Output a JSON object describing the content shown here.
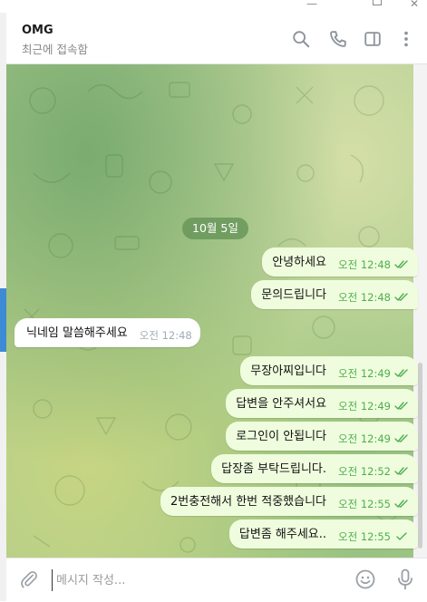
{
  "chat": {
    "name": "OMG",
    "status": "최근에 접속함"
  },
  "date_separator": "10월 5일",
  "messages": [
    {
      "text": "안녕하세요",
      "time": "오전 12:48",
      "direction": "out",
      "read": true
    },
    {
      "text": "문의드립니다",
      "time": "오전 12:48",
      "direction": "out",
      "read": true
    },
    {
      "text": "닉네임 말씀해주세요",
      "time": "오전 12:48",
      "direction": "in"
    },
    {
      "text": "무장아찌입니다",
      "time": "오전 12:49",
      "direction": "out",
      "read": true
    },
    {
      "text": "답변을 안주셔서요",
      "time": "오전 12:49",
      "direction": "out",
      "read": true
    },
    {
      "text": "로그인이 안됩니다",
      "time": "오전 12:49",
      "direction": "out",
      "read": true
    },
    {
      "text": "답장좀 부탁드립니다.",
      "time": "오전 12:52",
      "direction": "out",
      "read": true
    },
    {
      "text": "2번충전해서 한번 적중했습니다",
      "time": "오전 12:55",
      "direction": "out",
      "read": true
    },
    {
      "text": "답변좀 해주세요..",
      "time": "오전 12:55",
      "direction": "out",
      "read": false
    }
  ],
  "composer": {
    "placeholder": "메시지 작성..."
  },
  "colors": {
    "outgoing_bubble": "#effdde",
    "incoming_bubble": "#ffffff",
    "check_green": "#4fae4e",
    "accent": "#3d8ad5"
  },
  "icons": {
    "header": [
      "search-icon",
      "phone-icon",
      "sidebar-icon",
      "more-icon"
    ],
    "composer": [
      "paperclip-icon",
      "emoji-icon",
      "microphone-icon"
    ]
  }
}
